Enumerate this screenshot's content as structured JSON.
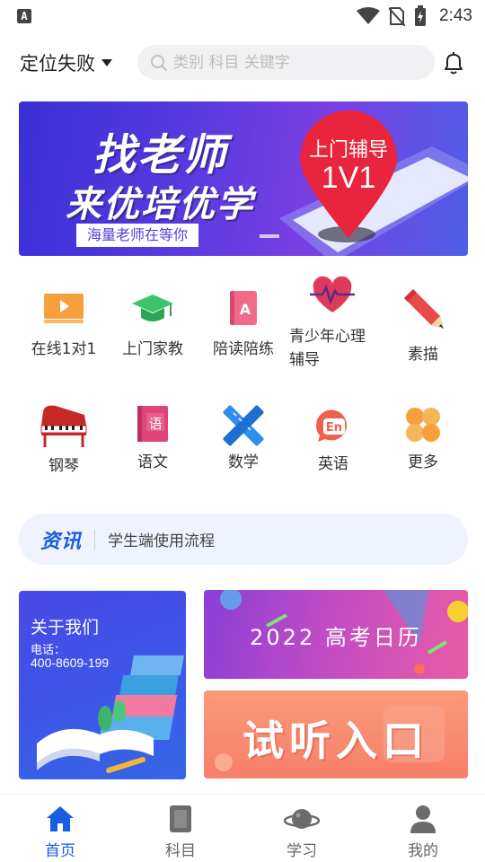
{
  "status_bar": {
    "time": "2:43",
    "app_badge": "A"
  },
  "header": {
    "location": "定位失败",
    "search_placeholder": "类别 科目 关键字"
  },
  "banner": {
    "title_line1": "找老师",
    "title_line2": "来优培优学",
    "subtitle": "海量老师在等你",
    "pin_line1": "上门辅导",
    "pin_line2": "1V1"
  },
  "categories": [
    {
      "label": "在线1对1",
      "icon": "video-play-icon",
      "color": "#f5a03c"
    },
    {
      "label": "上门家教",
      "icon": "graduation-cap-icon",
      "color": "#3cc46a"
    },
    {
      "label": "陪读陪练",
      "icon": "book-a-icon",
      "color": "#f06a8a"
    },
    {
      "label": "青少年心理\n辅导",
      "icon": "heart-pulse-icon",
      "color": "#e03a5a"
    },
    {
      "label": "素描",
      "icon": "pencil-icon",
      "color": "#e84a4a"
    },
    {
      "label": "钢琴",
      "icon": "piano-icon",
      "color": "#d32f2f"
    },
    {
      "label": "语文",
      "icon": "chinese-book-icon",
      "color": "#e0457a"
    },
    {
      "label": "数学",
      "icon": "ruler-pencil-icon",
      "color": "#2f8ef0"
    },
    {
      "label": "英语",
      "icon": "english-bubble-icon",
      "color": "#f06050"
    },
    {
      "label": "更多",
      "icon": "more-grid-icon",
      "color": "#f5a03c"
    }
  ],
  "news": {
    "tag": "资讯",
    "text": "学生端使用流程"
  },
  "cards": {
    "about_title": "关于我们",
    "about_phone_label": "电话：",
    "about_phone": "400-8609-199",
    "calendar_text": "2022 高考日历",
    "trial_text": "试听入口"
  },
  "bottom_nav": [
    {
      "label": "首页",
      "icon": "home-icon",
      "active": true
    },
    {
      "label": "科目",
      "icon": "book-icon",
      "active": false
    },
    {
      "label": "学习",
      "icon": "planet-icon",
      "active": false
    },
    {
      "label": "我的",
      "icon": "user-icon",
      "active": false
    }
  ],
  "colors": {
    "accent": "#1a5de0",
    "inactive": "#666666"
  }
}
